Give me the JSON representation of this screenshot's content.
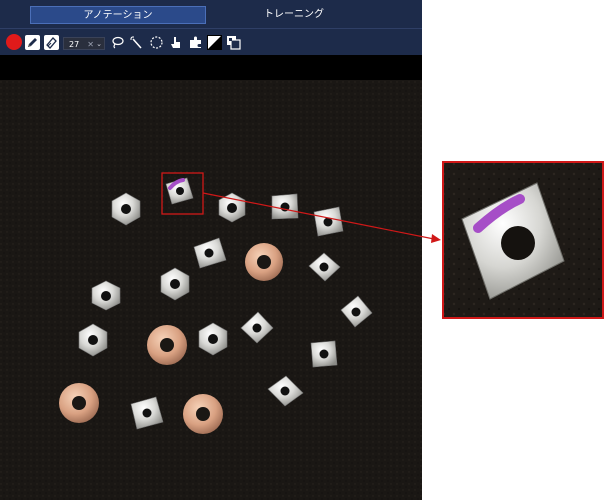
{
  "tabs": [
    {
      "label": "アノテーション",
      "active": true
    },
    {
      "label": "トレーニング",
      "active": false
    }
  ],
  "toolbar": {
    "brush_size": "27",
    "clear_symbol": "✕",
    "chevron": "⌄",
    "tools": [
      "record-button",
      "pencil-icon",
      "eraser-icon",
      "brush-size-select",
      "lasso-icon",
      "magic-wand-icon",
      "ellipse-select-icon",
      "hand-pointer-icon",
      "puzzle-icon",
      "contrast-icon",
      "layers-icon"
    ]
  },
  "colors": {
    "tab_bar": "#1d2b4a",
    "active_tab": "#2b4a8a",
    "record": "#e01a1a",
    "annotation": "#a64ec7",
    "highlight_box": "#d01818"
  },
  "canvas": {
    "description_objects": [
      "hex nuts",
      "square nuts",
      "copper washers"
    ]
  }
}
